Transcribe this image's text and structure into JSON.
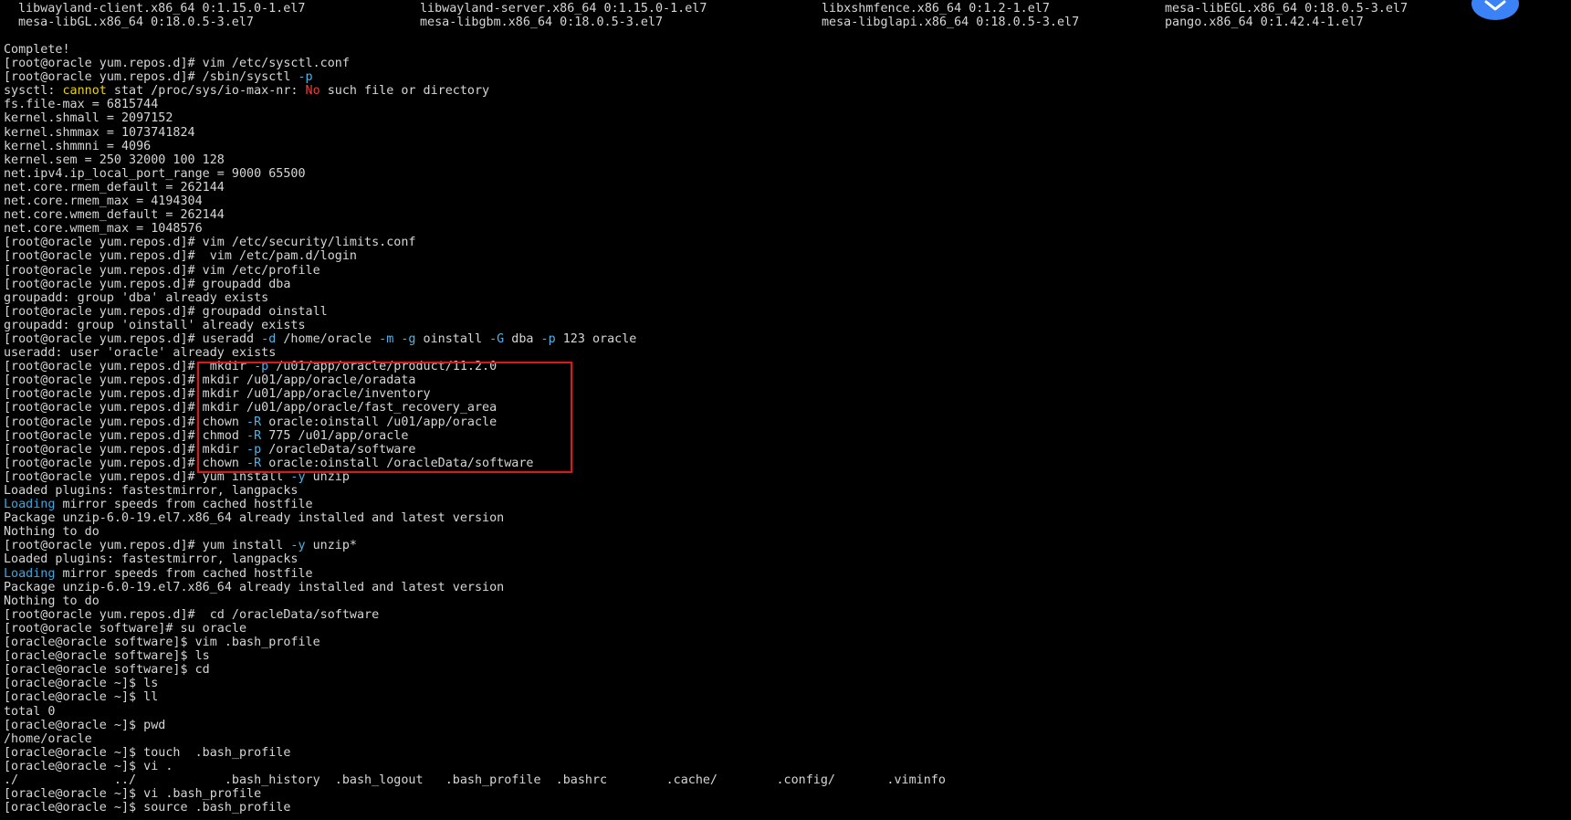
{
  "packages": {
    "rows": [
      [
        "libwayland-client.x86_64 0:1.15.0-1.el7",
        "libwayland-server.x86_64 0:1.15.0-1.el7",
        "libxshmfence.x86_64 0:1.2-1.el7",
        "mesa-libEGL.x86_64 0:18.0.5-3.el7"
      ],
      [
        "mesa-libGL.x86_64 0:18.0.5-3.el7",
        "mesa-libgbm.x86_64 0:18.0.5-3.el7",
        "mesa-libglapi.x86_64 0:18.0.5-3.el7",
        "pango.x86_64 0:1.42.4-1.el7"
      ]
    ]
  },
  "colors": {
    "background": "#000000",
    "text": "#d6d6d6",
    "flag": "#4fb3e8",
    "error": "#f23b3b",
    "warning": "#e7d21a",
    "info": "#3aa7e0",
    "highlight_box": "#e0161c",
    "badge": "#3b82f6"
  },
  "badge_icon": "app-logo-icon",
  "lines": [
    [
      {
        "t": "Complete!"
      }
    ],
    [
      {
        "t": "[root@oracle yum.repos.d]# vim /etc/sysctl.conf"
      }
    ],
    [
      {
        "t": "[root@oracle yum.repos.d]# /sbin/sysctl "
      },
      {
        "t": "-p",
        "s": "flag"
      }
    ],
    [
      {
        "t": "sysctl: "
      },
      {
        "t": "cannot",
        "s": "warn"
      },
      {
        "t": " stat /proc/sys/io-max-nr: "
      },
      {
        "t": "No",
        "s": "err"
      },
      {
        "t": " such file or directory"
      }
    ],
    [
      {
        "t": "fs.file-max = 6815744"
      }
    ],
    [
      {
        "t": "kernel.shmall = 2097152"
      }
    ],
    [
      {
        "t": "kernel.shmmax = 1073741824"
      }
    ],
    [
      {
        "t": "kernel.shmmni = 4096"
      }
    ],
    [
      {
        "t": "kernel.sem = 250 32000 100 128"
      }
    ],
    [
      {
        "t": "net.ipv4.ip_local_port_range = 9000 65500"
      }
    ],
    [
      {
        "t": "net.core.rmem_default = 262144"
      }
    ],
    [
      {
        "t": "net.core.rmem_max = 4194304"
      }
    ],
    [
      {
        "t": "net.core.wmem_default = 262144"
      }
    ],
    [
      {
        "t": "net.core.wmem_max = 1048576"
      }
    ],
    [
      {
        "t": "[root@oracle yum.repos.d]# vim /etc/security/limits.conf"
      }
    ],
    [
      {
        "t": "[root@oracle yum.repos.d]#  vim /etc/pam.d/login"
      }
    ],
    [
      {
        "t": "[root@oracle yum.repos.d]# vim /etc/profile"
      }
    ],
    [
      {
        "t": "[root@oracle yum.repos.d]# groupadd dba"
      }
    ],
    [
      {
        "t": "groupadd: group 'dba' already exists"
      }
    ],
    [
      {
        "t": "[root@oracle yum.repos.d]# groupadd oinstall"
      }
    ],
    [
      {
        "t": "groupadd: group 'oinstall' already exists"
      }
    ],
    [
      {
        "t": "[root@oracle yum.repos.d]# useradd "
      },
      {
        "t": "-d",
        "s": "flag"
      },
      {
        "t": " /home/oracle "
      },
      {
        "t": "-m",
        "s": "flag"
      },
      {
        "t": " "
      },
      {
        "t": "-g",
        "s": "flag"
      },
      {
        "t": " oinstall "
      },
      {
        "t": "-G",
        "s": "flag"
      },
      {
        "t": " dba "
      },
      {
        "t": "-p",
        "s": "flag"
      },
      {
        "t": " 123 oracle"
      }
    ],
    [
      {
        "t": "useradd: user 'oracle' already exists"
      }
    ],
    [
      {
        "t": "[root@oracle yum.repos.d]#  mkdir "
      },
      {
        "t": "-p",
        "s": "flag"
      },
      {
        "t": " /u01/app/oracle/product/11.2.0"
      }
    ],
    [
      {
        "t": "[root@oracle yum.repos.d]# mkdir /u01/app/oracle/oradata"
      }
    ],
    [
      {
        "t": "[root@oracle yum.repos.d]# mkdir /u01/app/oracle/inventory"
      }
    ],
    [
      {
        "t": "[root@oracle yum.repos.d]# mkdir /u01/app/oracle/fast_recovery_area"
      }
    ],
    [
      {
        "t": "[root@oracle yum.repos.d]# chown "
      },
      {
        "t": "-R",
        "s": "flag"
      },
      {
        "t": " oracle:oinstall /u01/app/oracle"
      }
    ],
    [
      {
        "t": "[root@oracle yum.repos.d]# chmod "
      },
      {
        "t": "-R",
        "s": "flag"
      },
      {
        "t": " 775 /u01/app/oracle"
      }
    ],
    [
      {
        "t": "[root@oracle yum.repos.d]# mkdir "
      },
      {
        "t": "-p",
        "s": "flag"
      },
      {
        "t": " /oracleData/software"
      }
    ],
    [
      {
        "t": "[root@oracle yum.repos.d]# chown "
      },
      {
        "t": "-R",
        "s": "flag"
      },
      {
        "t": " oracle:oinstall /oracleData/software"
      }
    ],
    [
      {
        "t": "[root@oracle yum.repos.d]# yum install "
      },
      {
        "t": "-y",
        "s": "flag"
      },
      {
        "t": " unzip"
      }
    ],
    [
      {
        "t": "Loaded plugins: fastestmirror, langpacks"
      }
    ],
    [
      {
        "t": "Loading",
        "s": "info"
      },
      {
        "t": " mirror speeds from cached hostfile"
      }
    ],
    [
      {
        "t": "Package unzip-6.0-19.el7.x86_64 already installed and latest version"
      }
    ],
    [
      {
        "t": "Nothing to do"
      }
    ],
    [
      {
        "t": "[root@oracle yum.repos.d]# yum install "
      },
      {
        "t": "-y",
        "s": "flag"
      },
      {
        "t": " unzip*"
      }
    ],
    [
      {
        "t": "Loaded plugins: fastestmirror, langpacks"
      }
    ],
    [
      {
        "t": "Loading",
        "s": "info"
      },
      {
        "t": " mirror speeds from cached hostfile"
      }
    ],
    [
      {
        "t": "Package unzip-6.0-19.el7.x86_64 already installed and latest version"
      }
    ],
    [
      {
        "t": "Nothing to do"
      }
    ],
    [
      {
        "t": "[root@oracle yum.repos.d]#  cd /oracleData/software"
      }
    ],
    [
      {
        "t": "[root@oracle software]# su oracle"
      }
    ],
    [
      {
        "t": "[oracle@oracle software]$ vim .bash_profile"
      }
    ],
    [
      {
        "t": "[oracle@oracle software]$ ls"
      }
    ],
    [
      {
        "t": "[oracle@oracle software]$ cd"
      }
    ],
    [
      {
        "t": "[oracle@oracle ~]$ ls"
      }
    ],
    [
      {
        "t": "[oracle@oracle ~]$ ll"
      }
    ],
    [
      {
        "t": "total 0"
      }
    ],
    [
      {
        "t": "[oracle@oracle ~]$ pwd"
      }
    ],
    [
      {
        "t": "/home/oracle"
      }
    ],
    [
      {
        "t": "[oracle@oracle ~]$ touch  .bash_profile"
      }
    ],
    [
      {
        "t": "[oracle@oracle ~]$ vi ."
      }
    ],
    [
      {
        "t": "./             ../            .bash_history  .bash_logout   .bash_profile  .bashrc        .cache/        .config/       .viminfo"
      }
    ],
    [
      {
        "t": "[oracle@oracle ~]$ vi .bash_profile"
      }
    ],
    [
      {
        "t": "[oracle@oracle ~]$ source .bash_profile"
      }
    ]
  ]
}
